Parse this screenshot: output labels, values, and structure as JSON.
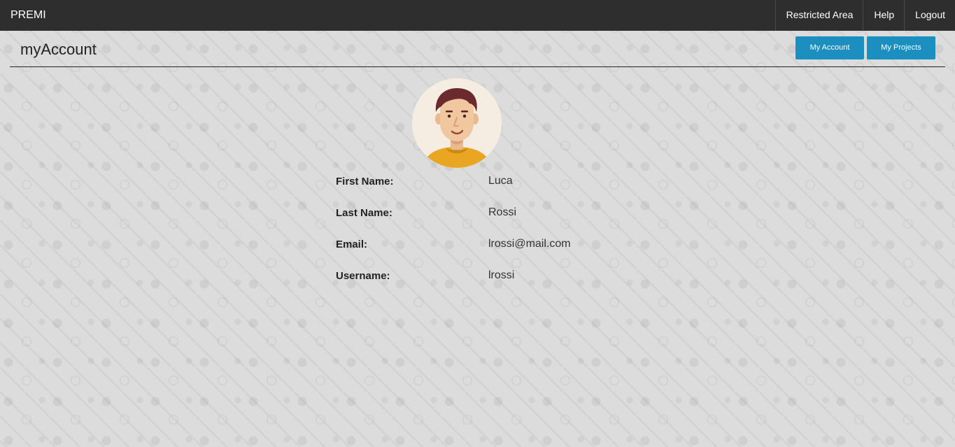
{
  "navbar": {
    "brand": "PREMI",
    "links": [
      {
        "label": "Restricted Area"
      },
      {
        "label": "Help"
      },
      {
        "label": "Logout"
      }
    ]
  },
  "header": {
    "title": "myAccount",
    "buttons": {
      "my_account": "My Account",
      "my_projects": "My Projects"
    }
  },
  "profile": {
    "avatar_icon": "user-avatar-icon",
    "fields": [
      {
        "label": "First Name:",
        "value": "Luca"
      },
      {
        "label": "Last Name:",
        "value": "Rossi"
      },
      {
        "label": "Email:",
        "value": "lrossi@mail.com"
      },
      {
        "label": "Username:",
        "value": "lrossi"
      }
    ]
  },
  "colors": {
    "navbar_bg": "#2e2e2e",
    "button_bg": "#1a8fc0",
    "page_bg": "#dcdcdc",
    "avatar_shirt": "#e8a623"
  }
}
